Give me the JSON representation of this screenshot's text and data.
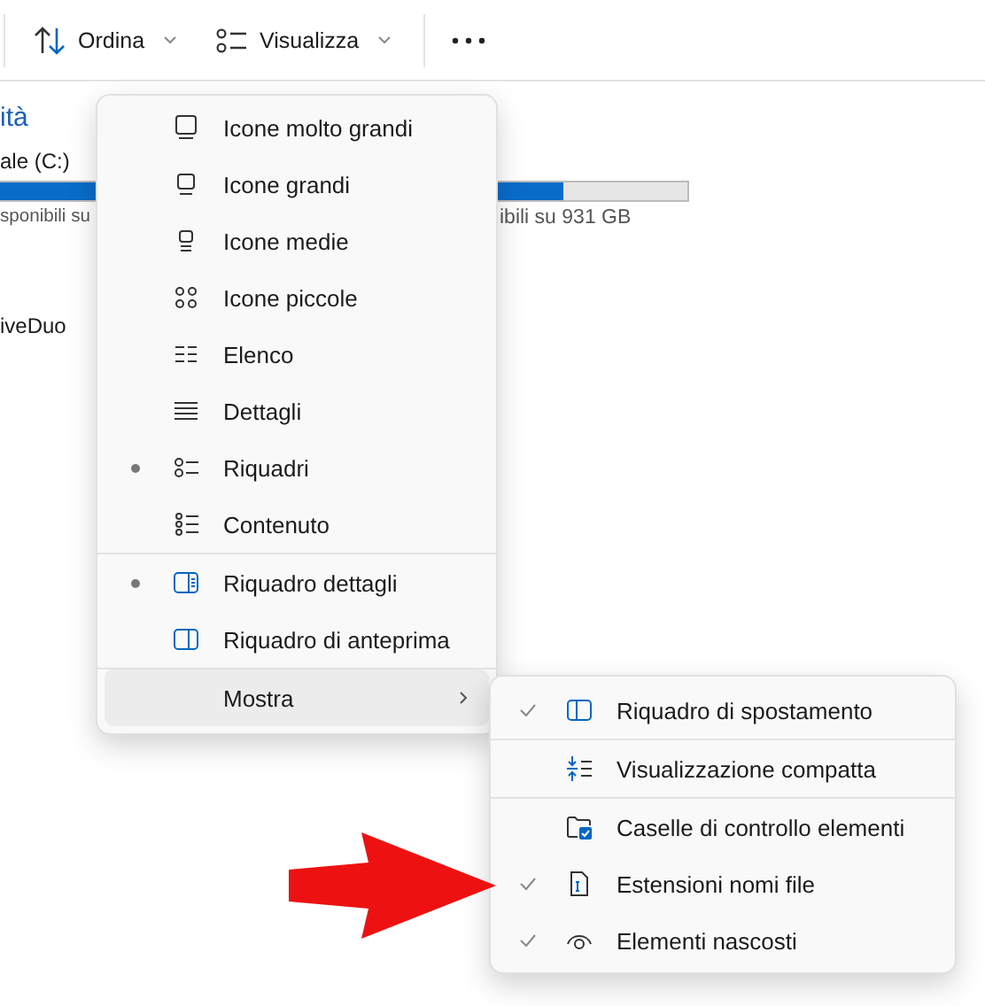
{
  "toolbar": {
    "buttons": [
      {
        "label": "Ordina"
      },
      {
        "label": "Visualizza"
      }
    ]
  },
  "background": {
    "heading": "ità",
    "drive_label": "ale (C:)",
    "storage": {
      "level": 0.82
    },
    "free_text_left": "sponibili su",
    "free_text_right": "ibili su 931 GB",
    "item_label": "iveDuo"
  },
  "view_menu": {
    "groups": [
      [
        {
          "label": "Icone molto grandi",
          "selected": false
        },
        {
          "label": "Icone grandi",
          "selected": false
        },
        {
          "label": "Icone medie",
          "selected": false
        },
        {
          "label": "Icone piccole",
          "selected": false
        },
        {
          "label": "Elenco",
          "selected": false
        },
        {
          "label": "Dettagli",
          "selected": false
        },
        {
          "label": "Riquadri",
          "selected": true
        },
        {
          "label": "Contenuto",
          "selected": false
        }
      ],
      [
        {
          "label": "Riquadro dettagli",
          "selected": true
        },
        {
          "label": "Riquadro di anteprima",
          "selected": false
        }
      ]
    ],
    "show_item": {
      "label": "Mostra",
      "expanded": true
    }
  },
  "show_menu": {
    "groups": [
      [
        {
          "label": "Riquadro di spostamento",
          "checked": true
        }
      ],
      [
        {
          "label": "Visualizzazione compatta",
          "checked": false
        }
      ],
      [
        {
          "label": "Caselle di controllo elementi",
          "checked": false
        },
        {
          "label": "Estensioni nomi file",
          "checked": true
        },
        {
          "label": "Elementi nascosti",
          "checked": true
        }
      ]
    ]
  }
}
